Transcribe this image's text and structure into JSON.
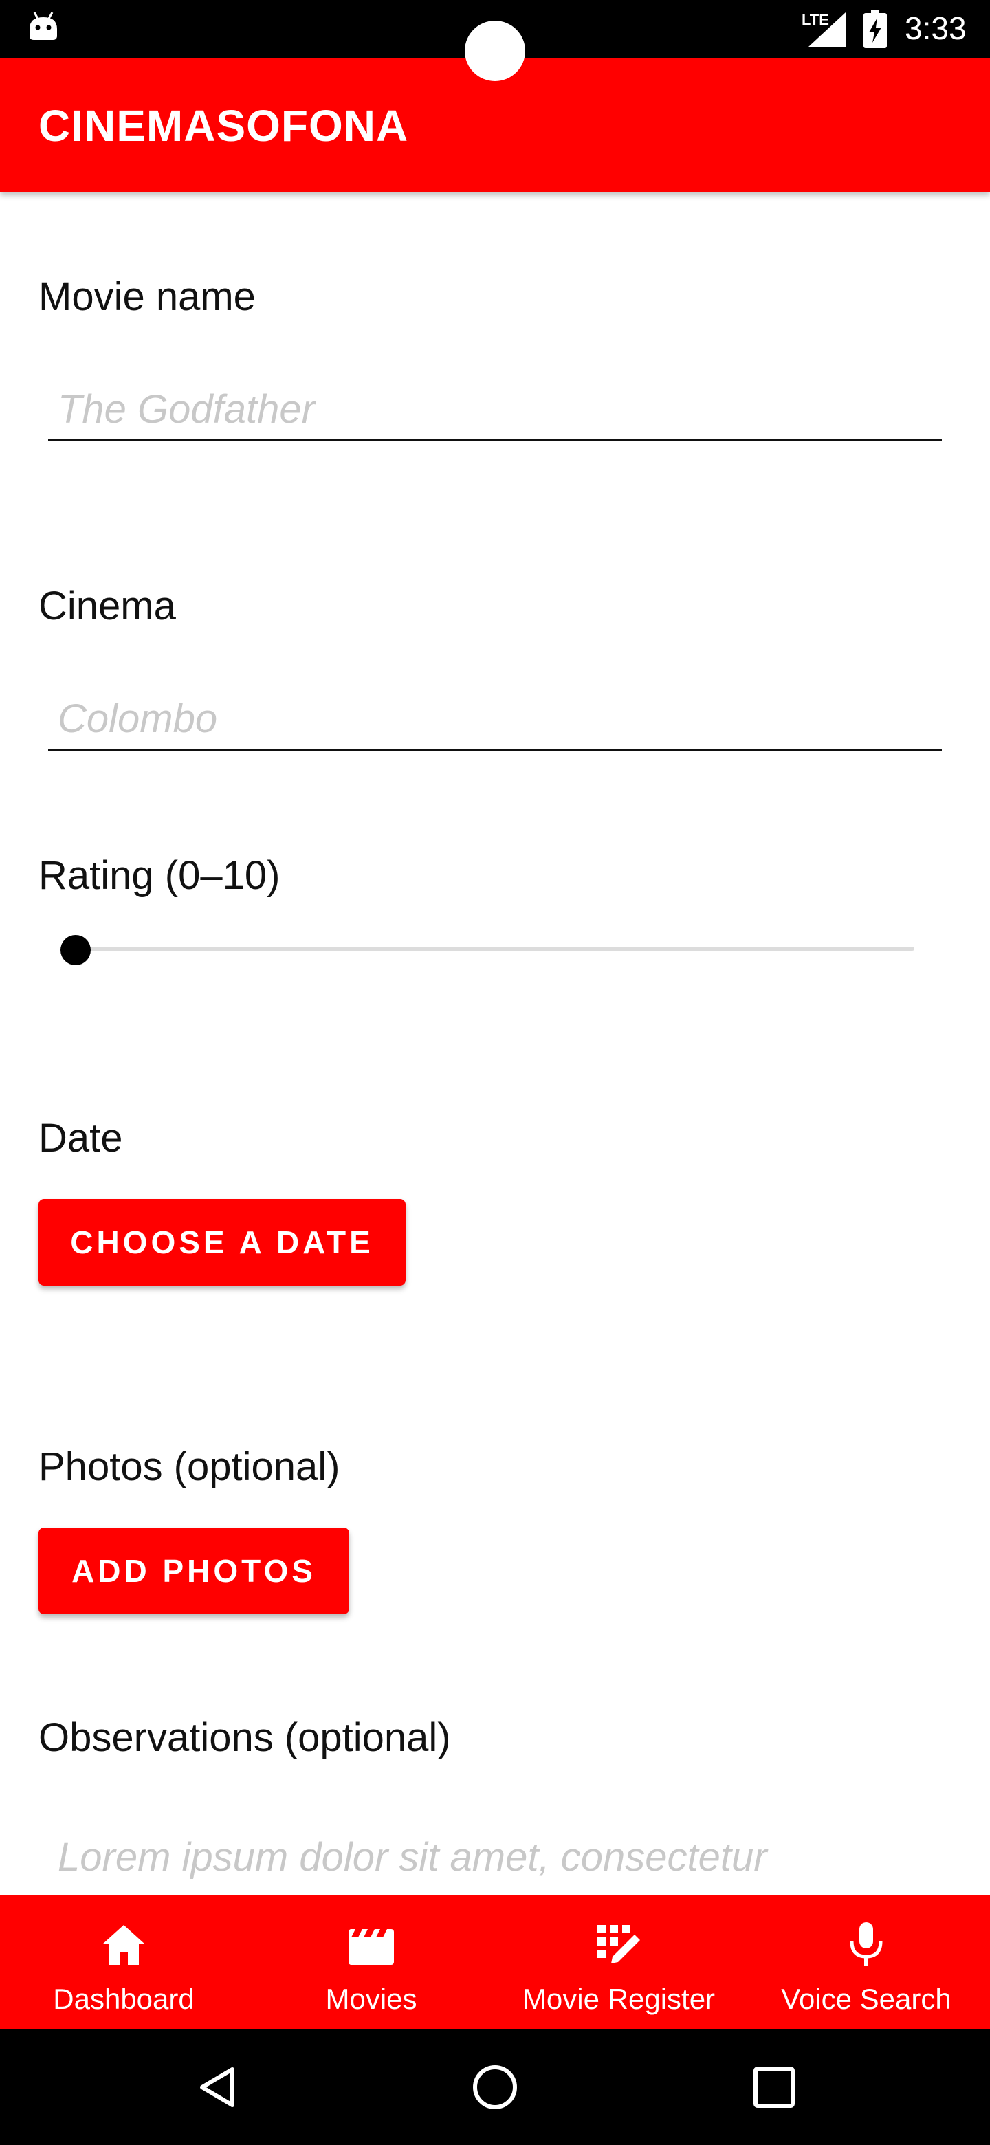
{
  "status_bar": {
    "network": "LTE",
    "time": "3:33",
    "icons": [
      "android-icon",
      "signal-icon",
      "battery-charging-icon"
    ]
  },
  "app_bar": {
    "title": "CINEMASOFONA",
    "color": "#ff0000"
  },
  "form": {
    "movie_name": {
      "label": "Movie name",
      "placeholder": "The Godfather"
    },
    "cinema": {
      "label": "Cinema",
      "placeholder": "Colombo"
    },
    "rating": {
      "label": "Rating (0–10)",
      "value": 0,
      "min": 0,
      "max": 10
    },
    "date": {
      "label": "Date",
      "button_label": "CHOOSE A DATE"
    },
    "photos": {
      "label": "Photos (optional)",
      "button_label": "ADD PHOTOS"
    },
    "observations": {
      "label": "Observations (optional)",
      "placeholder": "Lorem ipsum dolor sit amet, consectetur"
    }
  },
  "bottom_nav": {
    "items": [
      {
        "label": "Dashboard",
        "icon": "home-icon"
      },
      {
        "label": "Movies",
        "icon": "movie-clapper-icon"
      },
      {
        "label": "Movie Register",
        "icon": "register-edit-icon"
      },
      {
        "label": "Voice Search",
        "icon": "microphone-icon"
      }
    ]
  },
  "system_nav": {
    "icons": [
      "back-icon",
      "home-circle-icon",
      "recents-icon"
    ]
  }
}
